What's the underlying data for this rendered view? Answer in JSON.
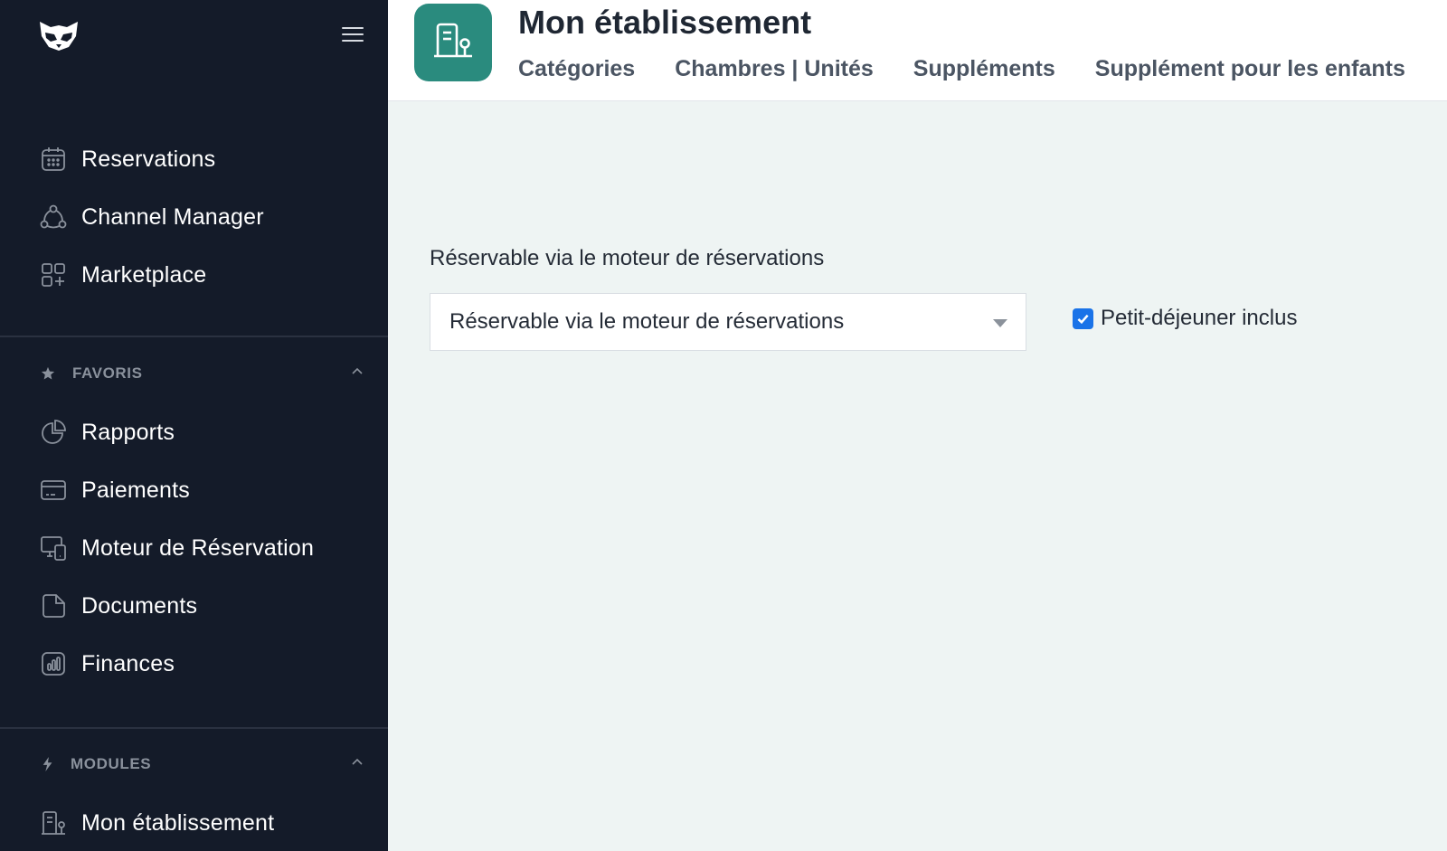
{
  "sidebar": {
    "main_items": [
      {
        "label": "Reservations",
        "icon": "calendar-icon"
      },
      {
        "label": "Channel Manager",
        "icon": "channel-network-icon"
      },
      {
        "label": "Marketplace",
        "icon": "apps-grid-icon"
      }
    ],
    "favorites": {
      "title": "FAVORIS",
      "items": [
        {
          "label": "Rapports",
          "icon": "pie-chart-icon"
        },
        {
          "label": "Paiements",
          "icon": "credit-card-icon"
        },
        {
          "label": "Moteur de Réservation",
          "icon": "devices-icon"
        },
        {
          "label": "Documents",
          "icon": "document-icon"
        },
        {
          "label": "Finances",
          "icon": "bar-chart-icon"
        }
      ]
    },
    "modules": {
      "title": "MODULES",
      "items": [
        {
          "label": "Mon établissement",
          "icon": "building-icon"
        }
      ]
    }
  },
  "header": {
    "title": "Mon établissement",
    "tabs": [
      "Catégories",
      "Chambres | Unités",
      "Suppléments",
      "Supplément pour les enfants"
    ]
  },
  "form": {
    "field_label": "Réservable via le moteur de réservations",
    "select_value": "Réservable via le moteur de réservations",
    "checkbox_label": "Petit-déjeuner inclus",
    "checkbox_checked": true
  },
  "colors": {
    "sidebar_bg": "#141b29",
    "accent": "#2a8b7e",
    "checkbox": "#1a73e8",
    "content_bg": "#eef4f3"
  }
}
